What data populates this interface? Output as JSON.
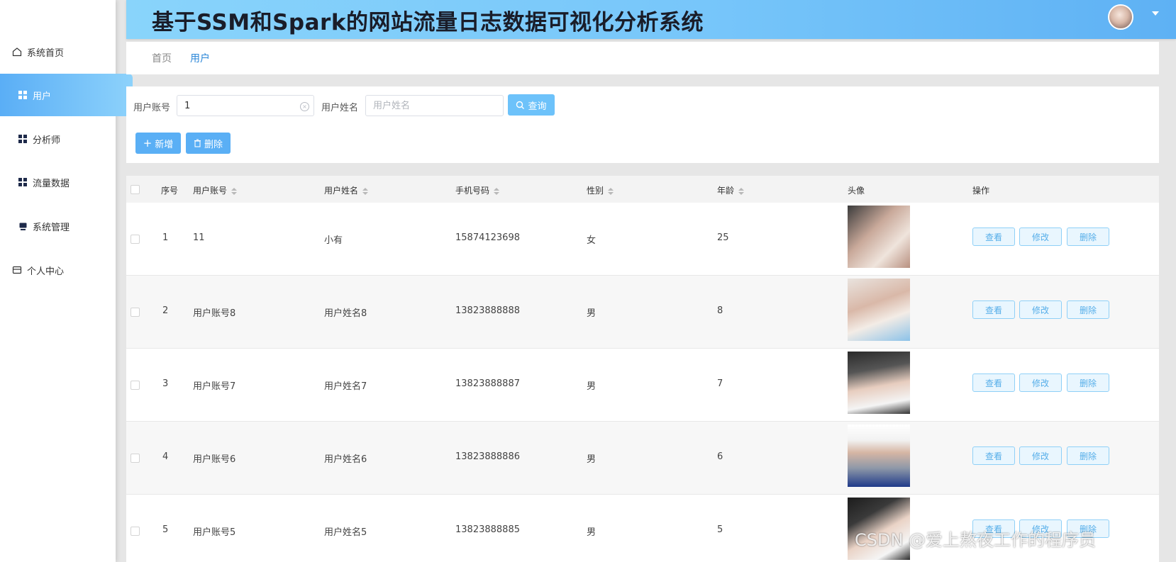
{
  "sidebar": {
    "items": [
      {
        "label": "系统首页",
        "icon": "home-icon"
      },
      {
        "label": "用户",
        "icon": "grid-icon",
        "active": true
      },
      {
        "label": "分析师",
        "icon": "grid-icon"
      },
      {
        "label": "流量数据",
        "icon": "grid-icon"
      },
      {
        "label": "系统管理",
        "icon": "monitor-icon"
      },
      {
        "label": "个人中心",
        "icon": "card-icon"
      }
    ]
  },
  "header": {
    "title": "基于SSM和Spark的网站流量日志数据可视化分析系统"
  },
  "breadcrumb": {
    "home": "首页",
    "current": "用户"
  },
  "search": {
    "account_label": "用户账号",
    "account_value": "1",
    "name_label": "用户姓名",
    "name_placeholder": "用户姓名",
    "query_label": "查询",
    "add_label": "新增",
    "delete_label": "删除"
  },
  "table": {
    "headers": {
      "index": "序号",
      "account": "用户账号",
      "name": "用户姓名",
      "phone": "手机号码",
      "gender": "性别",
      "age": "年龄",
      "avatar": "头像",
      "actions": "操作"
    },
    "action_labels": {
      "view": "查看",
      "edit": "修改",
      "delete": "删除"
    },
    "rows": [
      {
        "index": "1",
        "account": "11",
        "name": "小有",
        "phone": "15874123698",
        "gender": "女",
        "age": "25"
      },
      {
        "index": "2",
        "account": "用户账号8",
        "name": "用户姓名8",
        "phone": "13823888888",
        "gender": "男",
        "age": "8"
      },
      {
        "index": "3",
        "account": "用户账号7",
        "name": "用户姓名7",
        "phone": "13823888887",
        "gender": "男",
        "age": "7"
      },
      {
        "index": "4",
        "account": "用户账号6",
        "name": "用户姓名6",
        "phone": "13823888886",
        "gender": "男",
        "age": "6"
      },
      {
        "index": "5",
        "account": "用户账号5",
        "name": "用户姓名5",
        "phone": "13823888885",
        "gender": "男",
        "age": "5"
      }
    ]
  },
  "colors": {
    "accent": "#5aaff5",
    "header_gradient_start": "#89d4fb",
    "header_gradient_end": "#5eb1f4",
    "title": "#1a1d29"
  },
  "watermark": "CSDN @爱上熬夜工作的程序员"
}
